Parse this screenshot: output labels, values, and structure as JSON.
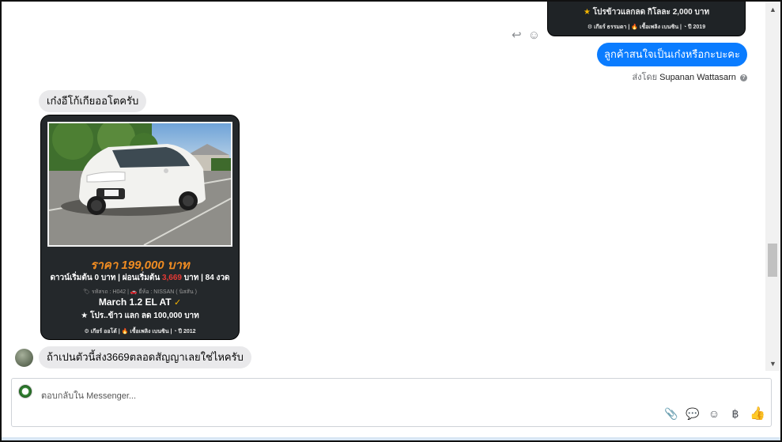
{
  "messages": {
    "top_card": {
      "promo": "โปรข้าวแลกลด กิโลละ 2,000 บาท",
      "specs": "⚙ เกียร์ ธรรมดา   |   🔥 เชื้อเพลิง เบนซิน   |   ◔ ปี 2019"
    },
    "outgoing": {
      "text": "ลูกค้าสนใจเป็นเก๋งหรือกะบะคะ",
      "sent_by_label": "ส่งโดย",
      "sent_by_name": "Supanan Wattasarn",
      "help": "?",
      "icons": "↩ ☺"
    },
    "incoming_1": {
      "text": "เก๋งอีโก้เกียออโตครับ"
    },
    "car_card": {
      "price": "ราคา 199,000 บาท",
      "terms_start": "ดาวน์เริ่มต้น 0 บาท | ผ่อนเริ่มต้น ",
      "terms_installment": "3,669",
      "terms_end": " บาท | 84 งวด",
      "meta": "🏷 รหัสรถ : H042 | 🚗 ยี่ห้อ : NISSAN ( นิสสัน )",
      "model": "March 1.2 EL AT",
      "model_check": "✓",
      "promo": "★ โปร..ข้าว แลก ลด 100,000 บาท",
      "specs": "⚙ เกียร์ ออโต้   |   🔥 เชื้อเพลิง เบนซิน   |   ◔ ปี 2012"
    },
    "incoming_2": {
      "text": "ถ้าเปนตัวนี้ส่ง3669ตลอดสัญญาเลยใช่ไหครับ"
    }
  },
  "composer": {
    "placeholder": "ตอบกลับใน Messenger...",
    "tools": {
      "attach": "📎",
      "sticker": "💬",
      "emoji": "☺",
      "payment": "฿",
      "like": "👍"
    }
  },
  "scrollbar": {
    "up": "▲",
    "down": "▼"
  },
  "colors": {
    "accent": "#0a7cff",
    "price": "#f08c22",
    "installment": "#e53935",
    "card_bg": "#24282b",
    "bubble_in": "#e9e9eb"
  }
}
